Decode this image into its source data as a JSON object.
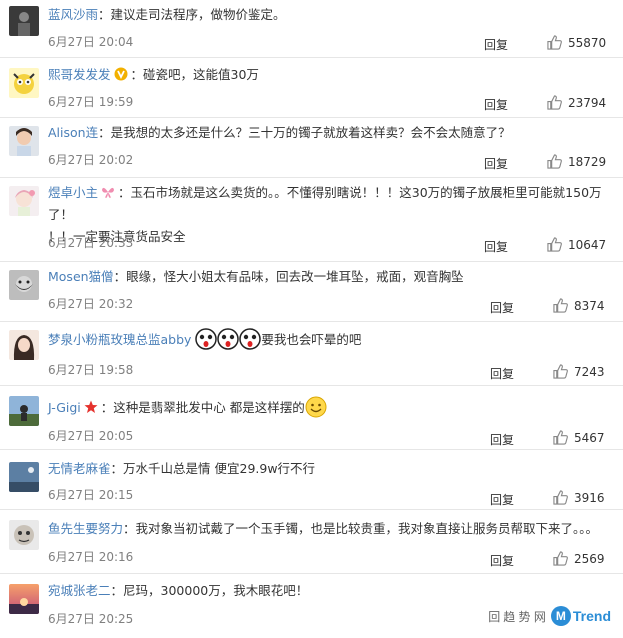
{
  "reply_label": "回复",
  "comments": [
    {
      "user": "蓝风沙雨",
      "text": "：建议走司法程序，做物价鉴定。",
      "time": "6月27日 20:04",
      "likes": "55870"
    },
    {
      "user": "熙哥发发发",
      "text": "：碰瓷吧，这能值30万",
      "time": "6月27日 19:59",
      "likes": "23794"
    },
    {
      "user": "Alison连",
      "text": "：是我想的太多还是什么？三十万的镯子就放着这样卖？会不会太随意了？",
      "time": "6月27日 20:02",
      "likes": "18729"
    },
    {
      "user": "煜卓小主",
      "text": "：玉石市场就是这么卖货的。。不懂得别瞎说！！！这30万的镯子放展柜里可能就150万了！",
      "text2": "！！一定要注意货品安全",
      "time": "6月27日 20:33",
      "likes": "10647"
    },
    {
      "user": "Mosen猫僧",
      "text": "：眼缘，怪大小姐太有品味，回去改一堆耳坠，戒面，观音胸坠",
      "time": "6月27日 20:32",
      "likes": "8374"
    },
    {
      "user": "梦泉小粉瓶玫瑰总监abby",
      "text": "要我也会吓晕的吧",
      "time": "6月27日 19:58",
      "likes": "7243"
    },
    {
      "user": "J-Gigi",
      "text": "：这种是翡翠批发中心 都是这样摆的",
      "time": "6月27日 20:05",
      "likes": "5467"
    },
    {
      "user": "无情老麻雀",
      "text": "：万水千山总是情 便宜29.9w行不行",
      "time": "6月27日 20:15",
      "likes": "3916"
    },
    {
      "user": "鱼先生要努力",
      "text": "：我对象当初试戴了一个玉手镯，也是比较贵重，我对象直接让服务员帮取下来了。。。",
      "time": "6月27日 20:16",
      "likes": "2569"
    },
    {
      "user": "宛城张老二",
      "text": "：尼玛，300000万，我木眼花吧！",
      "time": "6月27日 20:25",
      "likes": ""
    }
  ],
  "watermark": {
    "prefix": "回",
    "site": "趋 势 网",
    "logo": "M",
    "brand": "Trend"
  },
  "colors": {
    "username": "#eb7350",
    "username_alt": "#4a7fb8",
    "time": "#808080",
    "divider": "#e6e6e6"
  }
}
